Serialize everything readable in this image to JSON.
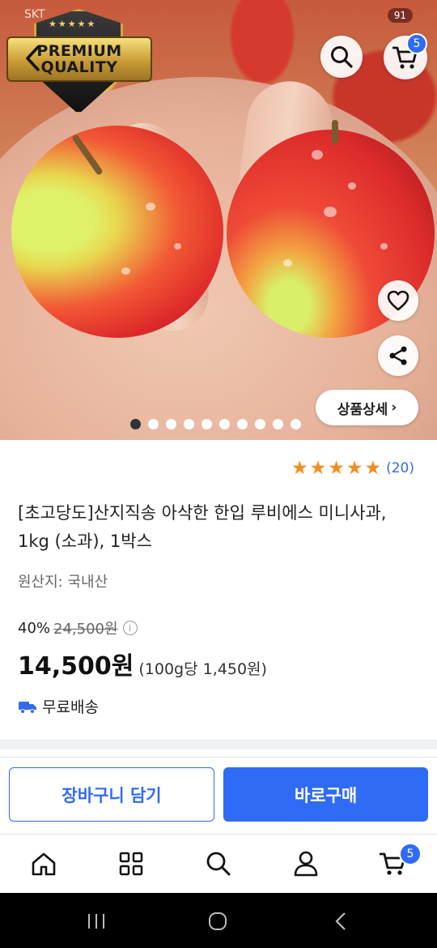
{
  "status_bar": {
    "carrier": "SKT",
    "battery": "91"
  },
  "hero": {
    "badge_lines": [
      "PREMIUM",
      "QUALITY"
    ],
    "badge_stars": "★★★★★",
    "cart_count": "5",
    "detail_button": "상품상세",
    "image_count": 10,
    "active_image": 1
  },
  "product": {
    "rating_stars": 5,
    "review_count": "(20)",
    "title": "[초고당도]산지직송 아삭한 한입 루비에스 미니사과, 1kg (소과), 1박스",
    "origin": "원산지: 국내산",
    "discount": "40%",
    "original_price": "24,500원",
    "price": "14,500원",
    "unit_price": "(100g당 1,450원)",
    "shipping": "무료배송"
  },
  "actions": {
    "add_to_cart": "장바구니 담기",
    "buy_now": "바로구매"
  },
  "tabbar": {
    "cart_count": "5"
  },
  "colors": {
    "accent": "#2f6bf5",
    "star": "#f68b1f"
  },
  "icons": [
    "back-icon",
    "search-icon",
    "cart-icon",
    "heart-icon",
    "share-icon",
    "home-icon",
    "grid-icon",
    "user-icon",
    "recent-apps-icon",
    "home-circle-icon",
    "back-nav-icon",
    "truck-icon",
    "info-icon"
  ]
}
